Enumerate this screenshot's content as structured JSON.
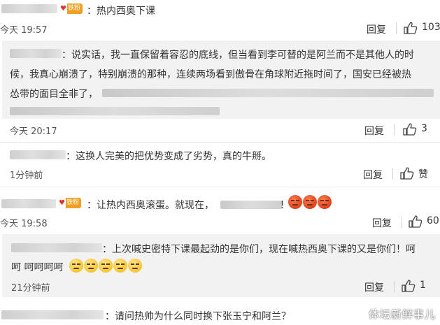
{
  "comments": [
    {
      "badge": "铁粉",
      "text": "：热内西奥下课",
      "time": "今天 19:57",
      "reply_label": "回复",
      "likes": "103"
    },
    {
      "sub": true,
      "lines": [
        "：说实话，我一直保留着容忍的底线，但当看到李可替的是阿兰而不是其他人的时",
        "候，我真心崩溃了，特别崩溃的那种，连续两场看到傲骨在角球附近拖时间了，国安已经被热",
        "怂带的面目全非了，"
      ],
      "time": "今天 20:17",
      "reply_label": "回复",
      "likes": "3"
    },
    {
      "sub": true,
      "text": "：这换人完美的把优势变成了劣势，真的牛掰。",
      "time": "1分钟前",
      "reply_label": "回复",
      "likes": "赞"
    },
    {
      "badge": "铁粉",
      "text": "：让热内西奥滚蛋。就现在，",
      "text_tail": "！",
      "time": "今天 19:58",
      "reply_label": "回复",
      "likes": "60"
    },
    {
      "sub": true,
      "lines": [
        "：上次喊史密特下课最起劲的是你们，现在喊热西奥下课的又是你们！呵",
        "呵    呵呵呵呵"
      ],
      "time": "21分钟前",
      "reply_label": "回复",
      "likes": "1"
    },
    {
      "text": "：请问热帅为什么同时换下张玉宁和阿兰？"
    }
  ],
  "watermark": "体坛新鲜事儿",
  "colors": {
    "badge": "#f0a020",
    "sub_bg": "#f2f2f2",
    "angry_emoji": "#e0401a",
    "smug_emoji": "#f4c530"
  }
}
